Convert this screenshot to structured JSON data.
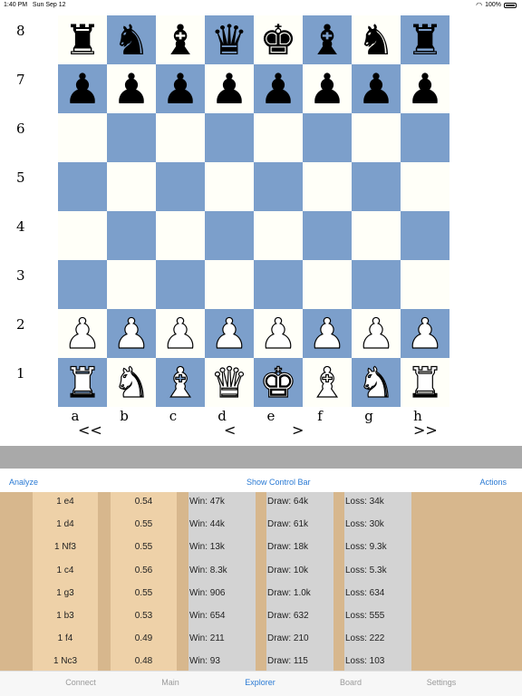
{
  "status_bar": {
    "time": "1:40 PM",
    "date": "Sun Sep 12",
    "wifi_icon": "wifi-icon",
    "battery": "100%"
  },
  "board": {
    "ranks": [
      "8",
      "7",
      "6",
      "5",
      "4",
      "3",
      "2",
      "1"
    ],
    "files": [
      "a",
      "b",
      "c",
      "d",
      "e",
      "f",
      "g",
      "h"
    ],
    "rows": [
      [
        "♜",
        "♞",
        "♝",
        "♛",
        "♚",
        "♝",
        "♞",
        "♜"
      ],
      [
        "♟",
        "♟",
        "♟",
        "♟",
        "♟",
        "♟",
        "♟",
        "♟"
      ],
      [
        "",
        "",
        "",
        "",
        "",
        "",
        "",
        ""
      ],
      [
        "",
        "",
        "",
        "",
        "",
        "",
        "",
        ""
      ],
      [
        "",
        "",
        "",
        "",
        "",
        "",
        "",
        ""
      ],
      [
        "",
        "",
        "",
        "",
        "",
        "",
        "",
        ""
      ],
      [
        "♟",
        "♟",
        "♟",
        "♟",
        "♟",
        "♟",
        "♟",
        "♟"
      ],
      [
        "♜",
        "♞",
        "♝",
        "♛",
        "♚",
        "♝",
        "♞",
        "♜"
      ]
    ],
    "colors": [
      "b",
      "b",
      "",
      "",
      "",
      "",
      "w",
      "w"
    ],
    "light_color": "#fffff8",
    "dark_color": "#7c9fcb"
  },
  "navigation": {
    "first": "<<",
    "prev": "<",
    "next": ">",
    "last": ">>"
  },
  "toolbar": {
    "analyze": "Analyze",
    "show_control_bar": "Show Control Bar",
    "actions": "Actions"
  },
  "explorer": {
    "rows": [
      {
        "move": "1 e4",
        "score": "0.54",
        "win": "Win: 47k",
        "draw": "Draw: 64k",
        "loss": "Loss: 34k"
      },
      {
        "move": "1 d4",
        "score": "0.55",
        "win": "Win: 44k",
        "draw": "Draw: 61k",
        "loss": "Loss: 30k"
      },
      {
        "move": "1 Nf3",
        "score": "0.55",
        "win": "Win: 13k",
        "draw": "Draw: 18k",
        "loss": "Loss: 9.3k"
      },
      {
        "move": "1 c4",
        "score": "0.56",
        "win": "Win: 8.3k",
        "draw": "Draw: 10k",
        "loss": "Loss: 5.3k"
      },
      {
        "move": "1 g3",
        "score": "0.55",
        "win": "Win: 906",
        "draw": "Draw: 1.0k",
        "loss": "Loss: 634"
      },
      {
        "move": "1 b3",
        "score": "0.53",
        "win": "Win: 654",
        "draw": "Draw: 632",
        "loss": "Loss: 555"
      },
      {
        "move": "1 f4",
        "score": "0.49",
        "win": "Win: 211",
        "draw": "Draw: 210",
        "loss": "Loss: 222"
      },
      {
        "move": "1 Nc3",
        "score": "0.48",
        "win": "Win: 93",
        "draw": "Draw: 115",
        "loss": "Loss: 103"
      }
    ]
  },
  "tabs": [
    {
      "label": "Connect",
      "active": false
    },
    {
      "label": "Main",
      "active": false
    },
    {
      "label": "Explorer",
      "active": true
    },
    {
      "label": "Board",
      "active": false
    },
    {
      "label": "Settings",
      "active": false
    }
  ]
}
